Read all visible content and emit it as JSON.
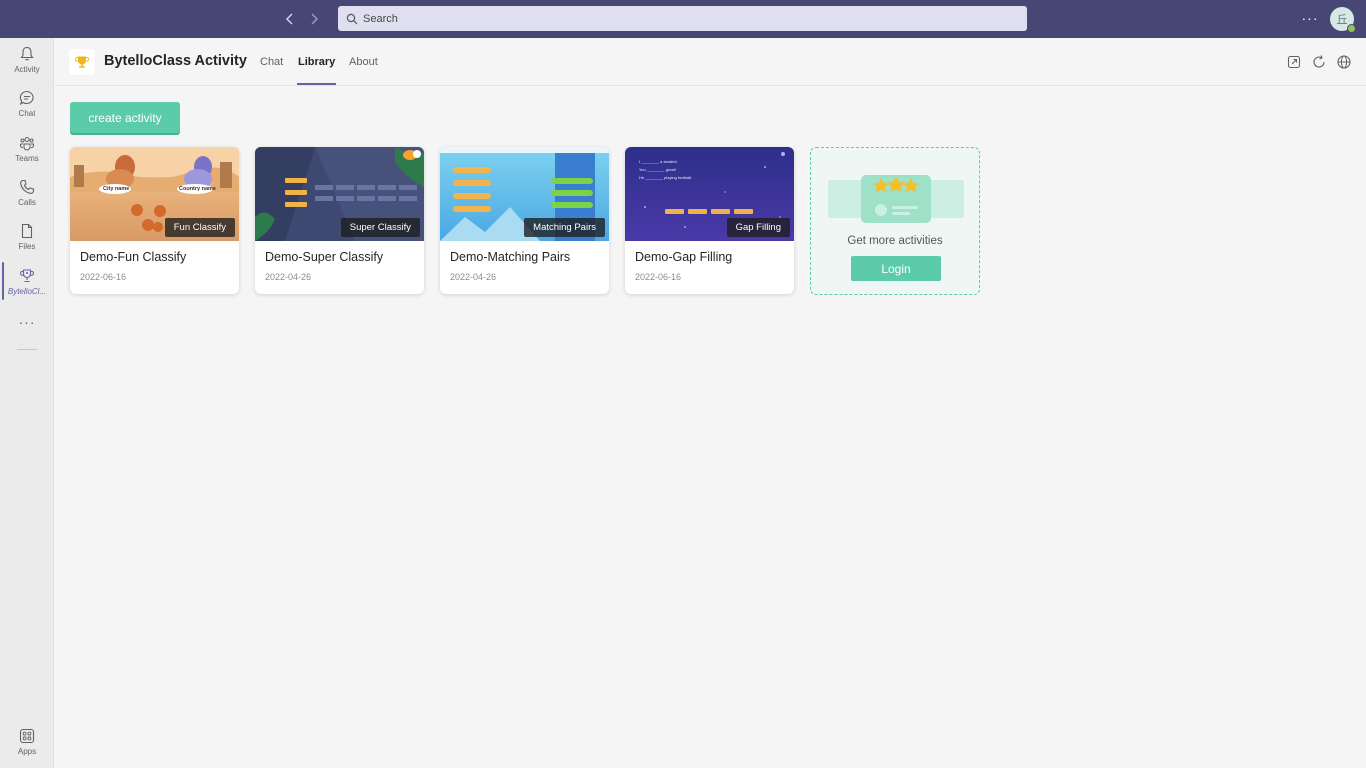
{
  "topbar": {
    "search_placeholder": "Search",
    "more_label": "···",
    "avatar_initial": "丘"
  },
  "rail": {
    "items": [
      {
        "label": "Activity",
        "icon": "bell-icon"
      },
      {
        "label": "Chat",
        "icon": "chat-icon"
      },
      {
        "label": "Teams",
        "icon": "teams-icon"
      },
      {
        "label": "Calls",
        "icon": "phone-icon"
      },
      {
        "label": "Files",
        "icon": "file-icon"
      },
      {
        "label": "BytelloCl...",
        "icon": "trophy-icon"
      }
    ],
    "more_label": "···",
    "apps_label": "Apps"
  },
  "header": {
    "app_title": "BytelloClass Activity",
    "tabs": [
      {
        "label": "Chat"
      },
      {
        "label": "Library",
        "active": true
      },
      {
        "label": "About"
      }
    ]
  },
  "main": {
    "create_label": "create activity",
    "cards": [
      {
        "title": "Demo-Fun Classify",
        "date": "2022-06-16",
        "tag": "Fun Classify",
        "thumb_labels": [
          "City name",
          "Country name"
        ]
      },
      {
        "title": "Demo-Super Classify",
        "date": "2022-04-26",
        "tag": "Super Classify"
      },
      {
        "title": "Demo-Matching Pairs",
        "date": "2022-04-26",
        "tag": "Matching Pairs"
      },
      {
        "title": "Demo-Gap Filling",
        "date": "2022-06-16",
        "tag": "Gap Filling",
        "thumb_lines": [
          "I ________ a student.",
          "You ________ great!",
          "He ________ playing football."
        ]
      }
    ],
    "more_card": {
      "text": "Get more activities",
      "login_label": "Login"
    }
  },
  "colors": {
    "topbar": "#464775",
    "accent": "#6264a7",
    "brand_green": "#5ccba9"
  }
}
